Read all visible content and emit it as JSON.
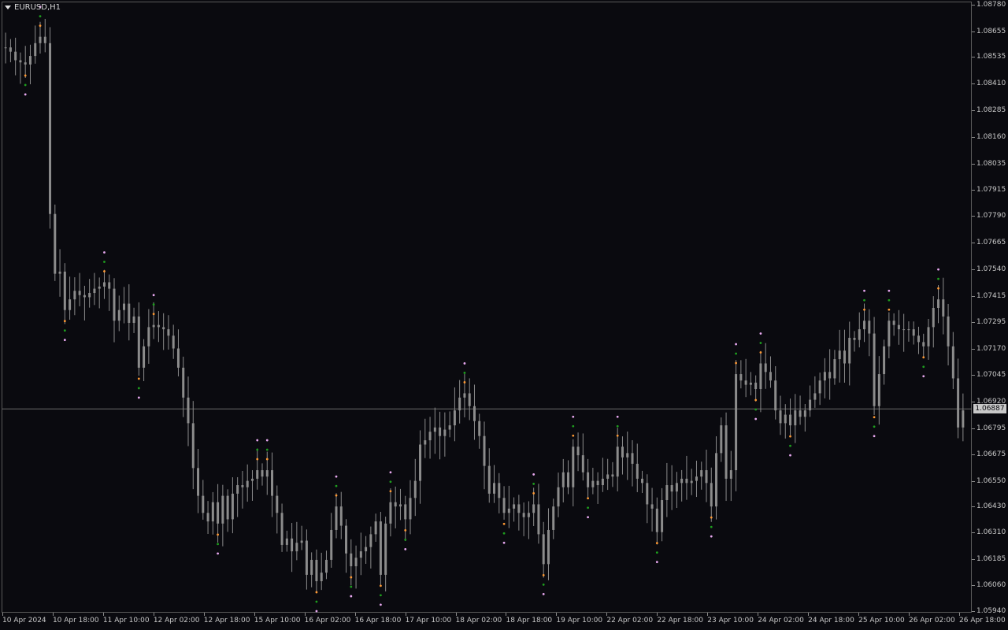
{
  "window": {
    "symbol_label": "EURUSD,H1",
    "dropdown_icon": "triangle-down-icon"
  },
  "price_axis": {
    "labels": [
      "1.08780",
      "1.08655",
      "1.08535",
      "1.08410",
      "1.08285",
      "1.08160",
      "1.08035",
      "1.07915",
      "1.07790",
      "1.07665",
      "1.07540",
      "1.07415",
      "1.07295",
      "1.07170",
      "1.07045",
      "1.06920",
      "1.06795",
      "1.06675",
      "1.06550",
      "1.06430",
      "1.06310",
      "1.06185",
      "1.06060",
      "1.05940"
    ],
    "current_price": "1.06887"
  },
  "time_axis": {
    "labels": [
      "10 Apr 2024",
      "10 Apr 18:00",
      "11 Apr 10:00",
      "12 Apr 02:00",
      "12 Apr 18:00",
      "15 Apr 10:00",
      "16 Apr 02:00",
      "16 Apr 18:00",
      "17 Apr 10:00",
      "18 Apr 02:00",
      "18 Apr 18:00",
      "19 Apr 10:00",
      "22 Apr 02:00",
      "22 Apr 18:00",
      "23 Apr 10:00",
      "24 Apr 02:00",
      "24 Apr 18:00",
      "25 Apr 10:00",
      "26 Apr 02:00",
      "26 Apr 18:00"
    ]
  },
  "colors": {
    "background": "#0a0a0f",
    "candle": "#8c8c8c",
    "grid_line": "#6a6a6a",
    "dot_orange": "#ff9933",
    "dot_green": "#1e9e1e",
    "dot_pink": "#e8a8f0"
  },
  "chart_data": {
    "type": "candlestick",
    "symbol": "EURUSD",
    "timeframe": "H1",
    "ylim": [
      1.0594,
      1.0878
    ],
    "current_price": 1.06887,
    "closes": [
      1.0858,
      1.0856,
      1.0852,
      1.0851,
      1.085,
      1.0854,
      1.086,
      1.0863,
      1.086,
      1.078,
      1.0752,
      1.0753,
      1.0735,
      1.074,
      1.0744,
      1.0742,
      1.0741,
      1.0743,
      1.0745,
      1.0746,
      1.0748,
      1.0745,
      1.073,
      1.0735,
      1.0738,
      1.0729,
      1.0732,
      1.0708,
      1.0718,
      1.0727,
      1.0728,
      1.0727,
      1.0726,
      1.0723,
      1.0717,
      1.0708,
      1.0694,
      1.0682,
      1.0661,
      1.0648,
      1.064,
      1.0636,
      1.0645,
      1.0635,
      1.0648,
      1.0637,
      1.0649,
      1.0653,
      1.0652,
      1.0655,
      1.0656,
      1.066,
      1.0657,
      1.066,
      1.0648,
      1.064,
      1.0625,
      1.0628,
      1.0622,
      1.0626,
      1.0627,
      1.0611,
      1.0618,
      1.0608,
      1.0612,
      1.0618,
      1.0632,
      1.0643,
      1.0634,
      1.0621,
      1.0615,
      1.0619,
      1.0622,
      1.0624,
      1.063,
      1.0636,
      1.0611,
      1.0635,
      1.0645,
      1.0643,
      1.0644,
      1.0637,
      1.0647,
      1.0655,
      1.0672,
      1.0674,
      1.0678,
      1.068,
      1.0676,
      1.0679,
      1.0681,
      1.0688,
      1.0694,
      1.0696,
      1.069,
      1.0683,
      1.0676,
      1.0662,
      1.0649,
      1.0654,
      1.0647,
      1.064,
      1.0642,
      1.0644,
      1.064,
      1.0638,
      1.064,
      1.0644,
      1.063,
      1.0616,
      1.0632,
      1.0643,
      1.0652,
      1.0659,
      1.0652,
      1.0671,
      1.0667,
      1.0659,
      1.0652,
      1.0655,
      1.0653,
      1.0656,
      1.0658,
      1.0657,
      1.0671,
      1.0666,
      1.0668,
      1.0663,
      1.0656,
      1.0654,
      1.0644,
      1.0642,
      1.0631,
      1.0646,
      1.0653,
      1.065,
      1.0654,
      1.0656,
      1.0654,
      1.0655,
      1.0657,
      1.066,
      1.0654,
      1.0643,
      1.0668,
      1.0681,
      1.0656,
      1.066,
      1.0705,
      1.0702,
      1.07,
      1.0701,
      1.0698,
      1.071,
      1.0706,
      1.0702,
      1.0688,
      1.0682,
      1.0686,
      1.0681,
      1.0688,
      1.0685,
      1.0688,
      1.0693,
      1.0696,
      1.0702,
      1.0706,
      1.0703,
      1.0712,
      1.0716,
      1.071,
      1.0722,
      1.0721,
      1.0726,
      1.073,
      1.0724,
      1.069,
      1.0705,
      1.0718,
      1.073,
      1.0728,
      1.0726,
      1.0726,
      1.0726,
      1.0723,
      1.072,
      1.0718,
      1.0727,
      1.0736,
      1.074,
      1.0732,
      1.0718,
      1.0703,
      1.068,
      1.0688
    ]
  }
}
